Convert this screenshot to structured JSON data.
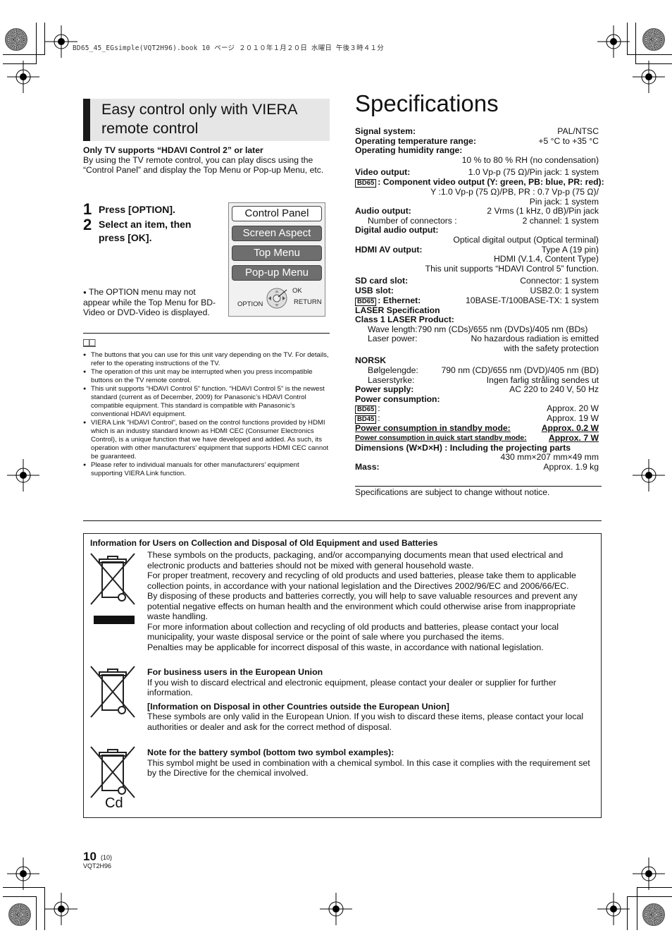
{
  "print_header": "BD65_45_EGsimple(VQT2H96).book  10 ページ  ２０１０年１月２０日  水曜日  午後３時４１分",
  "left": {
    "section_title": "Easy control only with VIERA remote control",
    "intro_bold": "Only TV supports “HDAVI Control 2” or later",
    "intro_text": "By using the TV remote control, you can play discs using the “Control Panel” and display the Top Menu or Pop-up Menu, etc.",
    "steps": [
      {
        "num": "1",
        "text": "Press [OPTION]."
      },
      {
        "num": "2",
        "text": "Select an item, then press [OK]."
      }
    ],
    "option_note": "The OPTION menu may not appear while the Top Menu for BD-Video or DVD-Video is displayed.",
    "panel": {
      "items": [
        "Control Panel",
        "Screen Aspect",
        "Top Menu",
        "Pop-up Menu"
      ],
      "selected": "Control Panel",
      "labels": {
        "ok": "OK",
        "option": "OPTION",
        "return": "RETURN"
      }
    },
    "notes": [
      "The buttons that you can use for this unit vary depending on the TV. For details, refer to the operating instructions of the TV.",
      "The operation of this unit may be interrupted when you press incompatible buttons on the TV remote control.",
      "This unit supports “HDAVI Control 5” function. “HDAVI Control 5” is the newest standard (current as of December, 2009) for Panasonic’s HDAVI Control compatible equipment. This standard is compatible with Panasonic’s conventional HDAVI equipment.",
      "VIERA Link “HDAVI Control”, based on the control functions provided by HDMI which is an industry standard known as HDMI CEC (Consumer Electronics Control), is a unique function that we have developed and added. As such, its operation with other manufacturers’ equipment that supports HDMI CEC cannot be guaranteed.",
      "Please refer to individual manuals for other manufacturers’ equipment supporting VIERA Link function."
    ]
  },
  "specs": {
    "title": "Specifications",
    "signal_system": {
      "label": "Signal system:",
      "value": "PAL/NTSC"
    },
    "temp": {
      "label": "Operating temperature range:",
      "value": "+5 °C to +35 °C"
    },
    "humidity": {
      "label": "Operating humidity range:",
      "value": "10 % to 80 % RH (no condensation)"
    },
    "video": {
      "label": "Video output:",
      "value": "1.0 Vp-p (75 Ω)/Pin jack: 1 system"
    },
    "component": {
      "badge": "BD65",
      "label": ": Component video output (Y: green, PB: blue, PR: red):",
      "value1": "Y :1.0 Vp-p (75 Ω)/PB, PR : 0.7 Vp-p (75 Ω)/",
      "value2": "Pin jack: 1 system"
    },
    "audio": {
      "label": "Audio output:",
      "value": "2 Vrms (1 kHz, 0 dB)/Pin jack"
    },
    "connectors": {
      "label": "Number of connectors :",
      "value": "2 channel: 1 system"
    },
    "digital_audio": {
      "label": "Digital audio output:",
      "value": "Optical digital output (Optical terminal)"
    },
    "hdmi": {
      "label": "HDMI AV output:",
      "value1": "Type A (19 pin)",
      "value2": "HDMI (V.1.4, Content Type)",
      "value3": "This unit supports “HDAVI Control 5” function."
    },
    "sd": {
      "label": "SD card slot:",
      "value": "Connector: 1 system"
    },
    "usb": {
      "label": "USB slot:",
      "value": "USB2.0: 1 system"
    },
    "ethernet": {
      "badge": "BD65",
      "label": ": Ethernet:",
      "value": "10BASE-T/100BASE-TX: 1 system"
    },
    "laser_spec": "LASER Specification",
    "laser_class": "Class 1 LASER Product:",
    "wavelength": "Wave length:790 nm (CDs)/655 nm (DVDs)/405 nm (BDs)",
    "laser_power": {
      "label": "Laser power:",
      "value1": "No hazardous radiation is emitted",
      "value2": "with the safety protection"
    },
    "norsk": "NORSK",
    "bolgelengde": {
      "label": "Bølgelengde:",
      "value": "790 nm (CD)/655 nm (DVD)/405 nm (BD)"
    },
    "laserstyrke": {
      "label": "Laserstyrke:",
      "value": "Ingen farlig stråling sendes ut"
    },
    "power_supply": {
      "label": "Power supply:",
      "value": "AC 220 to 240 V, 50 Hz"
    },
    "power_consumption": "Power consumption:",
    "pc_bd65": {
      "badge": "BD65",
      "value": "Approx. 20 W"
    },
    "pc_bd45": {
      "badge": "BD45",
      "value": "Approx. 19 W"
    },
    "standby": {
      "label": "Power consumption in standby mode:",
      "value": "Approx. 0.2 W"
    },
    "quick_standby": {
      "label": "Power consumption in quick start standby mode:",
      "value": "Approx. 7 W"
    },
    "dimensions": {
      "label": "Dimensions (W×D×H) : Including the projecting parts",
      "value": "430 mm×207 mm×49 mm"
    },
    "mass": {
      "label": "Mass:",
      "value": "Approx. 1.9 kg"
    },
    "footnote": "Specifications are subject to change without notice."
  },
  "disposal": {
    "title": "Information for Users on Collection and Disposal of Old Equipment and used Batteries",
    "p1": "These symbols on the products, packaging, and/or accompanying documents mean that used electrical and electronic products and batteries should not be mixed with general household waste.",
    "p2": "For proper treatment, recovery and recycling of old products and used batteries, please take them to applicable collection points, in accordance with your national legislation and the Directives 2002/96/EC and 2006/66/EC.",
    "p3": "By disposing of these products and batteries correctly, you will help to save valuable resources and prevent any potential negative effects on human health and the environment which could otherwise arise from inappropriate waste handling.",
    "p4": "For more information about collection and recycling of old products and batteries, please contact your local municipality, your waste disposal service or the point of sale where you purchased the items.",
    "p5": "Penalties may be applicable for incorrect disposal of this waste, in accordance with national legislation.",
    "business_title": "For business users in the European Union",
    "business_text": "If you wish to discard electrical and electronic equipment, please contact your dealer or supplier for further information.",
    "outside_title": "[Information on Disposal in other Countries outside the European Union]",
    "outside_text": "These symbols are only valid in the European Union. If you wish to discard these items, please contact your local authorities or dealer and ask for the correct method of disposal.",
    "battery_title": "Note for the battery symbol (bottom two symbol examples):",
    "battery_text": "This symbol might be used in combination with a chemical symbol. In this case it complies with the requirement set by the Directive for the chemical involved.",
    "chemical_symbol": "Cd"
  },
  "footer": {
    "page": "10",
    "page_sub": "(10)",
    "code": "VQT2H96"
  }
}
